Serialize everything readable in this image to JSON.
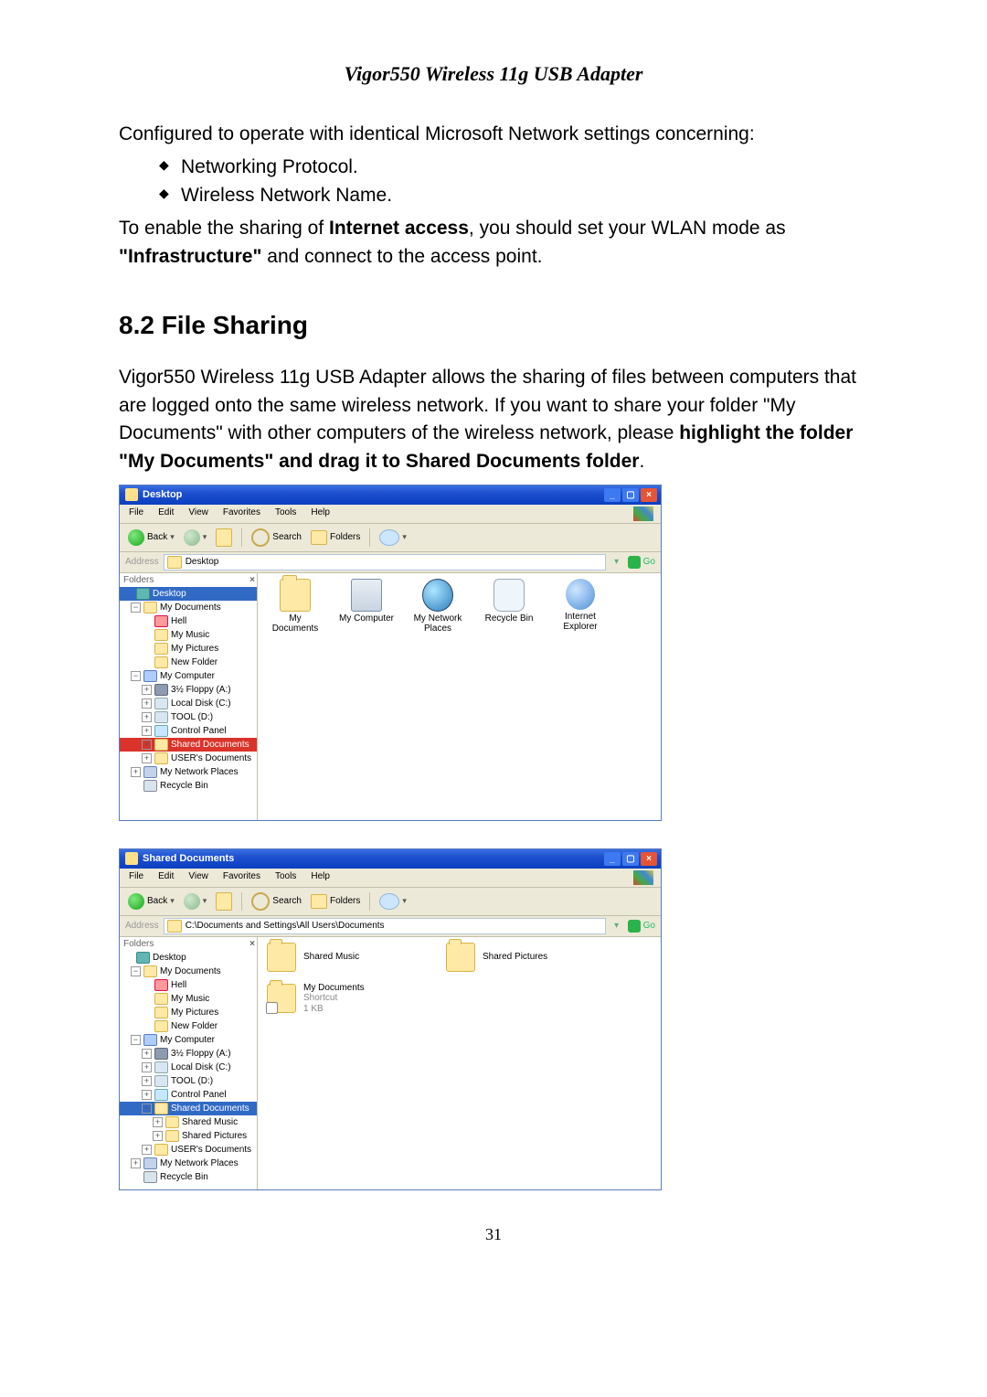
{
  "doc_title": "Vigor550 Wireless 11g USB Adapter",
  "para_intro": "Configured to operate with identical Microsoft Network settings concerning:",
  "bullets": [
    "Networking Protocol.",
    "Wireless Network Name."
  ],
  "para_enable_1": "To enable the sharing of ",
  "para_enable_bold": "Internet access",
  "para_enable_2": ", you should set your WLAN mode as ",
  "para_enable_bold2": "\"Infrastructure\"",
  "para_enable_3": " and connect to the access point.",
  "section_82": "8.2 File Sharing",
  "para_share_1": "Vigor550 Wireless 11g USB Adapter allows the sharing of files between computers that are logged onto the same wireless network. If you want to share your folder \"My Documents\" with other computers of the wireless network, please ",
  "para_share_bold": "highlight the folder \"My Documents\" and drag it to Shared Documents folder",
  "para_share_2": ".",
  "page_number": "31",
  "win_common": {
    "menu": [
      "File",
      "Edit",
      "View",
      "Favorites",
      "Tools",
      "Help"
    ],
    "back": "Back",
    "search": "Search",
    "folders": "Folders",
    "address_label": "Address",
    "go": "Go",
    "tree_label": "Folders",
    "tree_close": "×"
  },
  "win1": {
    "title": "Desktop",
    "address": "Desktop",
    "icons": [
      {
        "name": "My Documents",
        "type": "folder"
      },
      {
        "name": "My Computer",
        "type": "pc"
      },
      {
        "name": "My Network Places",
        "type": "globe"
      },
      {
        "name": "Recycle Bin",
        "type": "bin"
      },
      {
        "name": "Internet Explorer",
        "type": "ie"
      }
    ],
    "tree": [
      {
        "label": "Desktop",
        "ico": "desk",
        "sel": "sel",
        "ind": 0,
        "sp": true
      },
      {
        "label": "My Documents",
        "ico": "yellow",
        "ind": 1,
        "pm": "−"
      },
      {
        "label": "Hell",
        "ico": "red",
        "ind": 2,
        "sp": true
      },
      {
        "label": "My Music",
        "ico": "yellow",
        "ind": 2,
        "sp": true
      },
      {
        "label": "My Pictures",
        "ico": "yellow",
        "ind": 2,
        "sp": true
      },
      {
        "label": "New Folder",
        "ico": "yellow",
        "ind": 2,
        "sp": true
      },
      {
        "label": "My Computer",
        "ico": "blue",
        "ind": 1,
        "pm": "−"
      },
      {
        "label": "3½ Floppy (A:)",
        "ico": "flp",
        "ind": 2,
        "pm": "+"
      },
      {
        "label": "Local Disk (C:)",
        "ico": "drv",
        "ind": 2,
        "pm": "+"
      },
      {
        "label": "TOOL (D:)",
        "ico": "drv",
        "ind": 2,
        "pm": "+"
      },
      {
        "label": "Control Panel",
        "ico": "cp",
        "ind": 2,
        "pm": "+"
      },
      {
        "label": "Shared Documents",
        "ico": "yellow",
        "ind": 2,
        "pm": "+",
        "sel": "sel-red"
      },
      {
        "label": "USER's Documents",
        "ico": "yellow",
        "ind": 2,
        "pm": "+"
      },
      {
        "label": "My Network Places",
        "ico": "net",
        "ind": 1,
        "pm": "+"
      },
      {
        "label": "Recycle Bin",
        "ico": "bin",
        "ind": 1,
        "sp": true
      }
    ]
  },
  "win2": {
    "title": "Shared Documents",
    "address": "C:\\Documents and Settings\\All Users\\Documents",
    "items": [
      {
        "name": "Shared Music",
        "type": "folder",
        "sub": ""
      },
      {
        "name": "Shared Pictures",
        "type": "folder",
        "sub": ""
      },
      {
        "name": "My Documents",
        "type": "shortcut",
        "sub": "Shortcut\n1 KB"
      }
    ],
    "tree": [
      {
        "label": "Desktop",
        "ico": "desk",
        "ind": 0,
        "sp": true
      },
      {
        "label": "My Documents",
        "ico": "yellow",
        "ind": 1,
        "pm": "−"
      },
      {
        "label": "Hell",
        "ico": "red",
        "ind": 2,
        "sp": true
      },
      {
        "label": "My Music",
        "ico": "yellow",
        "ind": 2,
        "sp": true
      },
      {
        "label": "My Pictures",
        "ico": "yellow",
        "ind": 2,
        "sp": true
      },
      {
        "label": "New Folder",
        "ico": "yellow",
        "ind": 2,
        "sp": true
      },
      {
        "label": "My Computer",
        "ico": "blue",
        "ind": 1,
        "pm": "−"
      },
      {
        "label": "3½ Floppy (A:)",
        "ico": "flp",
        "ind": 2,
        "pm": "+"
      },
      {
        "label": "Local Disk (C:)",
        "ico": "drv",
        "ind": 2,
        "pm": "+"
      },
      {
        "label": "TOOL (D:)",
        "ico": "drv",
        "ind": 2,
        "pm": "+"
      },
      {
        "label": "Control Panel",
        "ico": "cp",
        "ind": 2,
        "pm": "+"
      },
      {
        "label": "Shared Documents",
        "ico": "yellow",
        "ind": 2,
        "pm": "−",
        "sel": "sel"
      },
      {
        "label": "Shared Music",
        "ico": "yellow",
        "ind": 3,
        "pm": "+"
      },
      {
        "label": "Shared Pictures",
        "ico": "yellow",
        "ind": 3,
        "pm": "+"
      },
      {
        "label": "USER's Documents",
        "ico": "yellow",
        "ind": 2,
        "pm": "+"
      },
      {
        "label": "My Network Places",
        "ico": "net",
        "ind": 1,
        "pm": "+"
      },
      {
        "label": "Recycle Bin",
        "ico": "bin",
        "ind": 1,
        "sp": true
      }
    ]
  }
}
